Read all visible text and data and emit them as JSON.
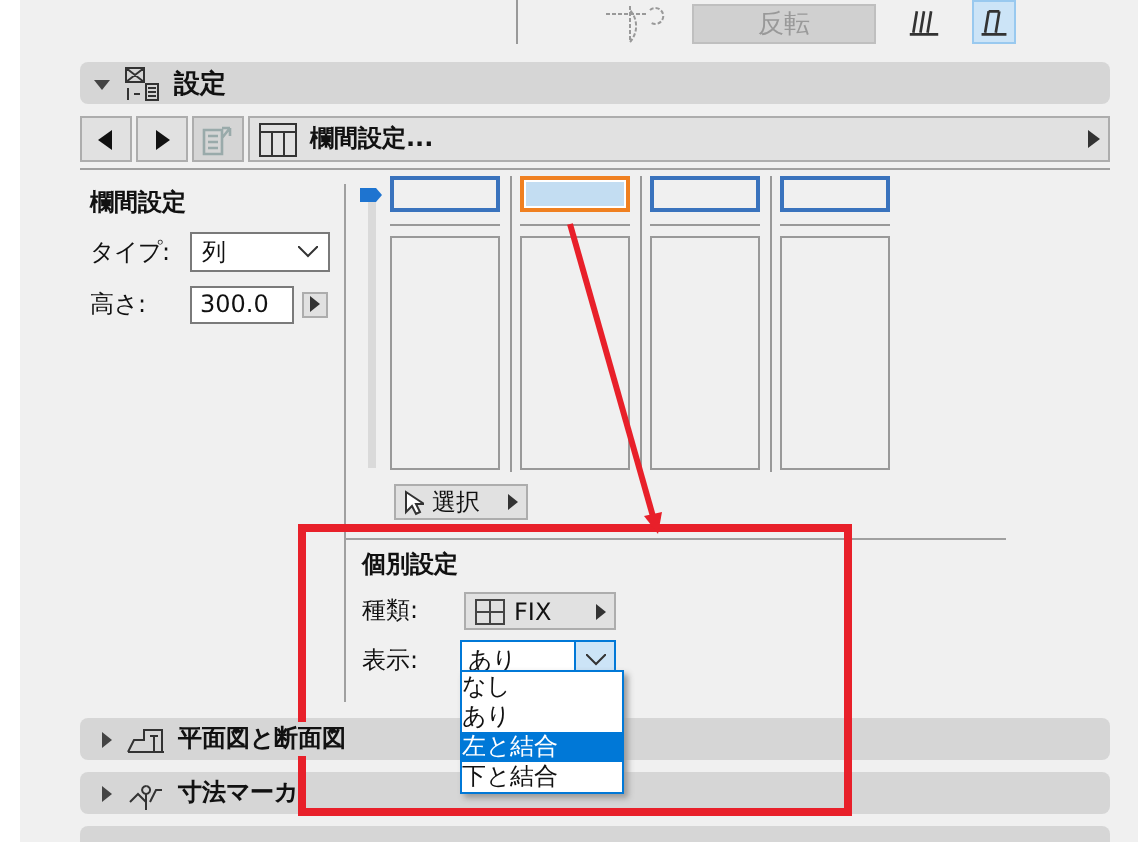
{
  "top_bar": {
    "flip_button": {
      "label": "反転",
      "disabled": true
    },
    "view_buttons": [
      {
        "selected": false
      },
      {
        "selected": true
      }
    ]
  },
  "section": {
    "title": "設定",
    "expanded": true
  },
  "toolbar": {
    "dropdown": "欄間設定..."
  },
  "transom": {
    "title": "欄間設定",
    "type_label": "タイプ:",
    "type_value": "列",
    "height_label": "高さ:",
    "height_value": "300.0"
  },
  "slider": {
    "level": 1
  },
  "panes": [
    {
      "selected": false
    },
    {
      "selected": true
    },
    {
      "selected": false
    },
    {
      "selected": false
    }
  ],
  "select_button": "選択",
  "individual": {
    "title": "個別設定",
    "kind_label": "種類:",
    "kind_value": "FIX",
    "display_label": "表示:",
    "display_value": "あり",
    "options": [
      {
        "label": "なし",
        "selected": false
      },
      {
        "label": "あり",
        "selected": false
      },
      {
        "label": "左と結合",
        "selected": true
      },
      {
        "label": "下と結合",
        "selected": false
      }
    ]
  },
  "collapsed_sections": [
    {
      "title": "平面図と断面図",
      "expanded": false
    },
    {
      "title": "寸法マーカ",
      "expanded": false
    }
  ]
}
